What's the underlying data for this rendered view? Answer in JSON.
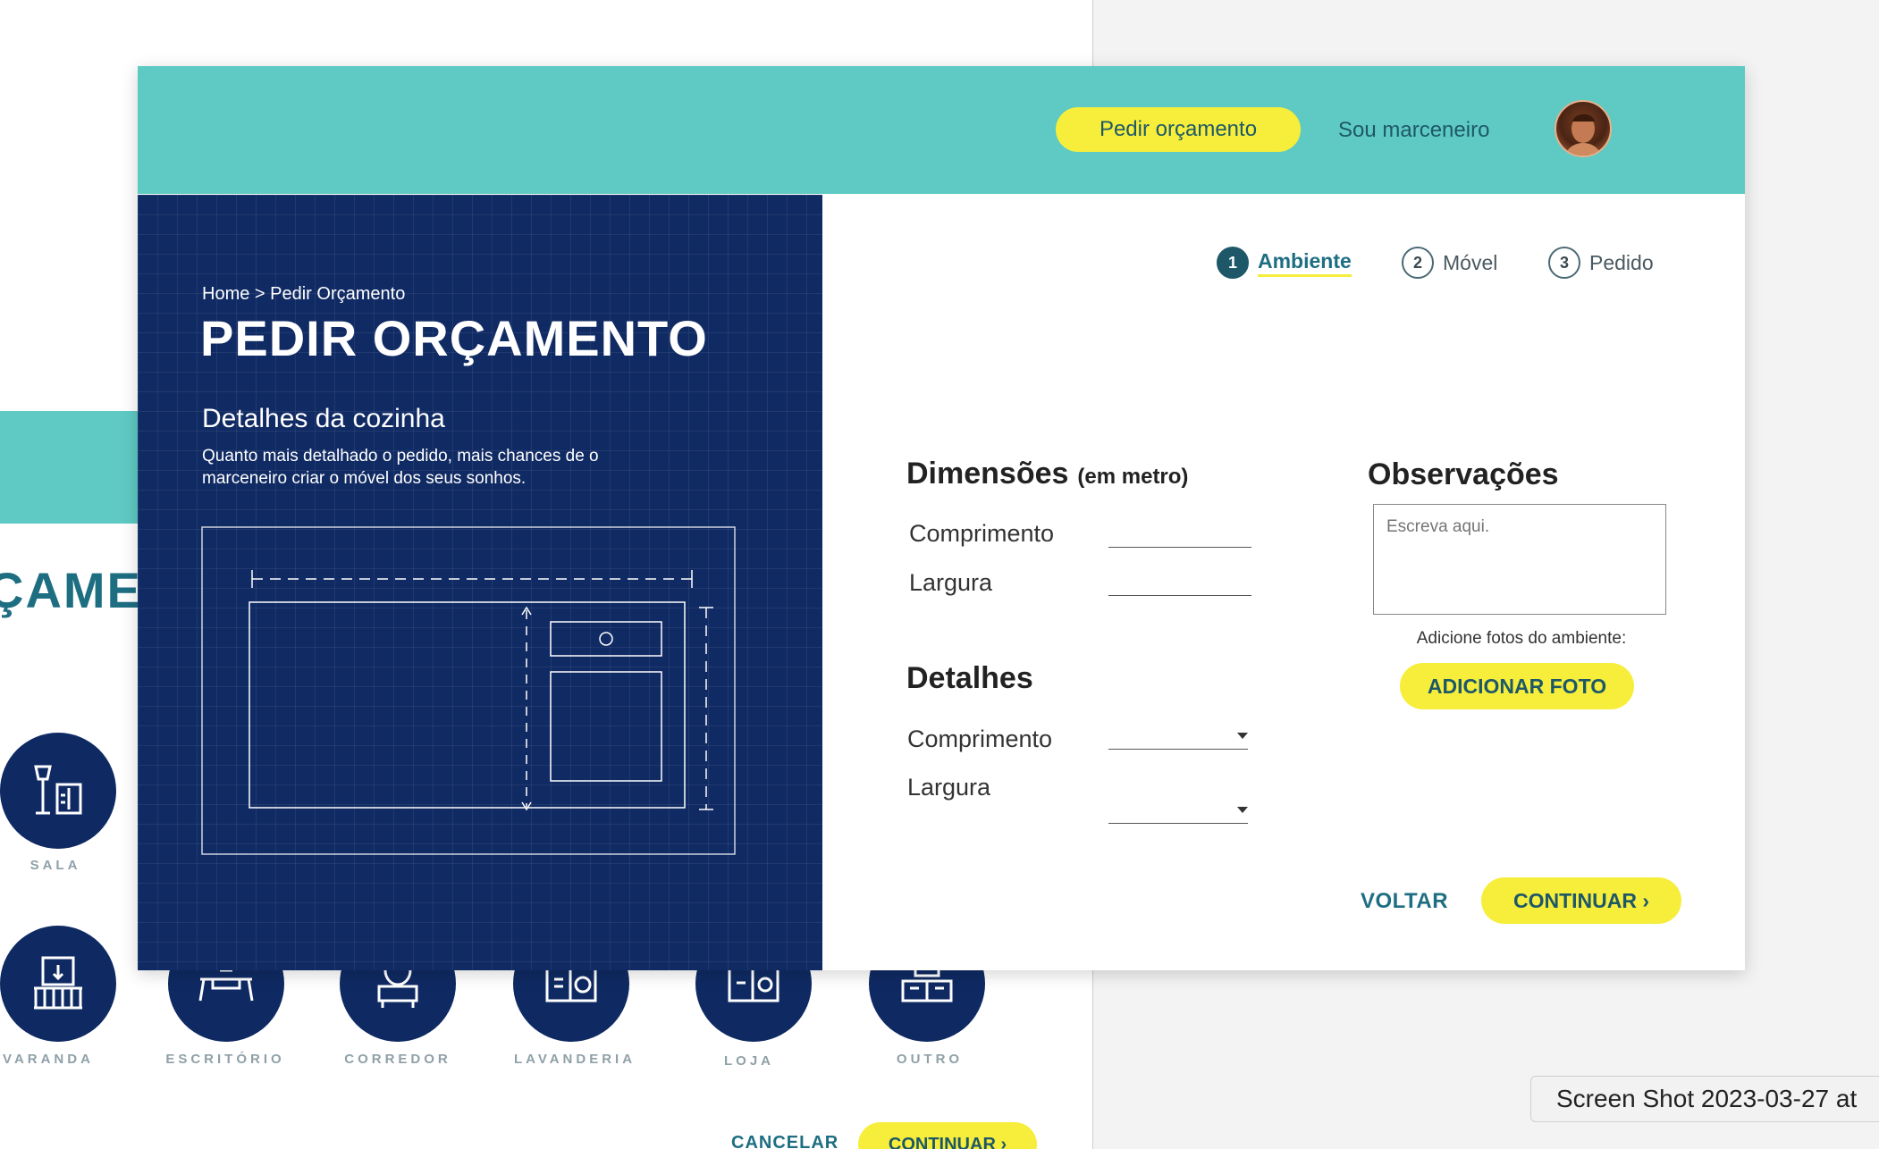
{
  "background": {
    "title_fragment": "ÇAMEI",
    "rooms": [
      {
        "label": "SALA"
      },
      {
        "label": "VARANDA"
      },
      {
        "label": "ESCRITÓRIO"
      },
      {
        "label": "CORREDOR"
      },
      {
        "label": "LAVANDERIA"
      },
      {
        "label": "LOJA"
      },
      {
        "label": "OUTRO"
      }
    ],
    "cancel_label": "CANCELAR",
    "continue_label": "CONTINUAR ›"
  },
  "screenshot_label": "Screen Shot 2023-03-27 at",
  "header": {
    "request_button": "Pedir orçamento",
    "carpenter_link": "Sou marceneiro"
  },
  "left_panel": {
    "breadcrumb": "Home > Pedir Orçamento",
    "title": "PEDIR ORÇAMENTO",
    "section_title": "Detalhes da cozinha",
    "section_description": "Quanto mais detalhado o pedido, mais chances de o marceneiro criar o móvel dos seus sonhos."
  },
  "steps": [
    {
      "number": "1",
      "label": "Ambiente"
    },
    {
      "number": "2",
      "label": "Móvel"
    },
    {
      "number": "3",
      "label": "Pedido"
    }
  ],
  "dimensions": {
    "title": "Dimensões",
    "unit": "(em metro)",
    "length_label": "Comprimento",
    "width_label": "Largura"
  },
  "details": {
    "title": "Detalhes",
    "length_label": "Comprimento",
    "width_label": "Largura"
  },
  "observations": {
    "title": "Observações",
    "placeholder": "Escreva aqui.",
    "photos_label": "Adicione fotos do ambiente:",
    "add_photo_button": "ADICIONAR FOTO"
  },
  "footer": {
    "back_label": "VOLTAR",
    "continue_label": "CONTINUAR ›"
  },
  "colors": {
    "teal": "#5ecac3",
    "navy": "#102a63",
    "yellow": "#f6ee3b",
    "accent_text": "#1e6e82"
  }
}
